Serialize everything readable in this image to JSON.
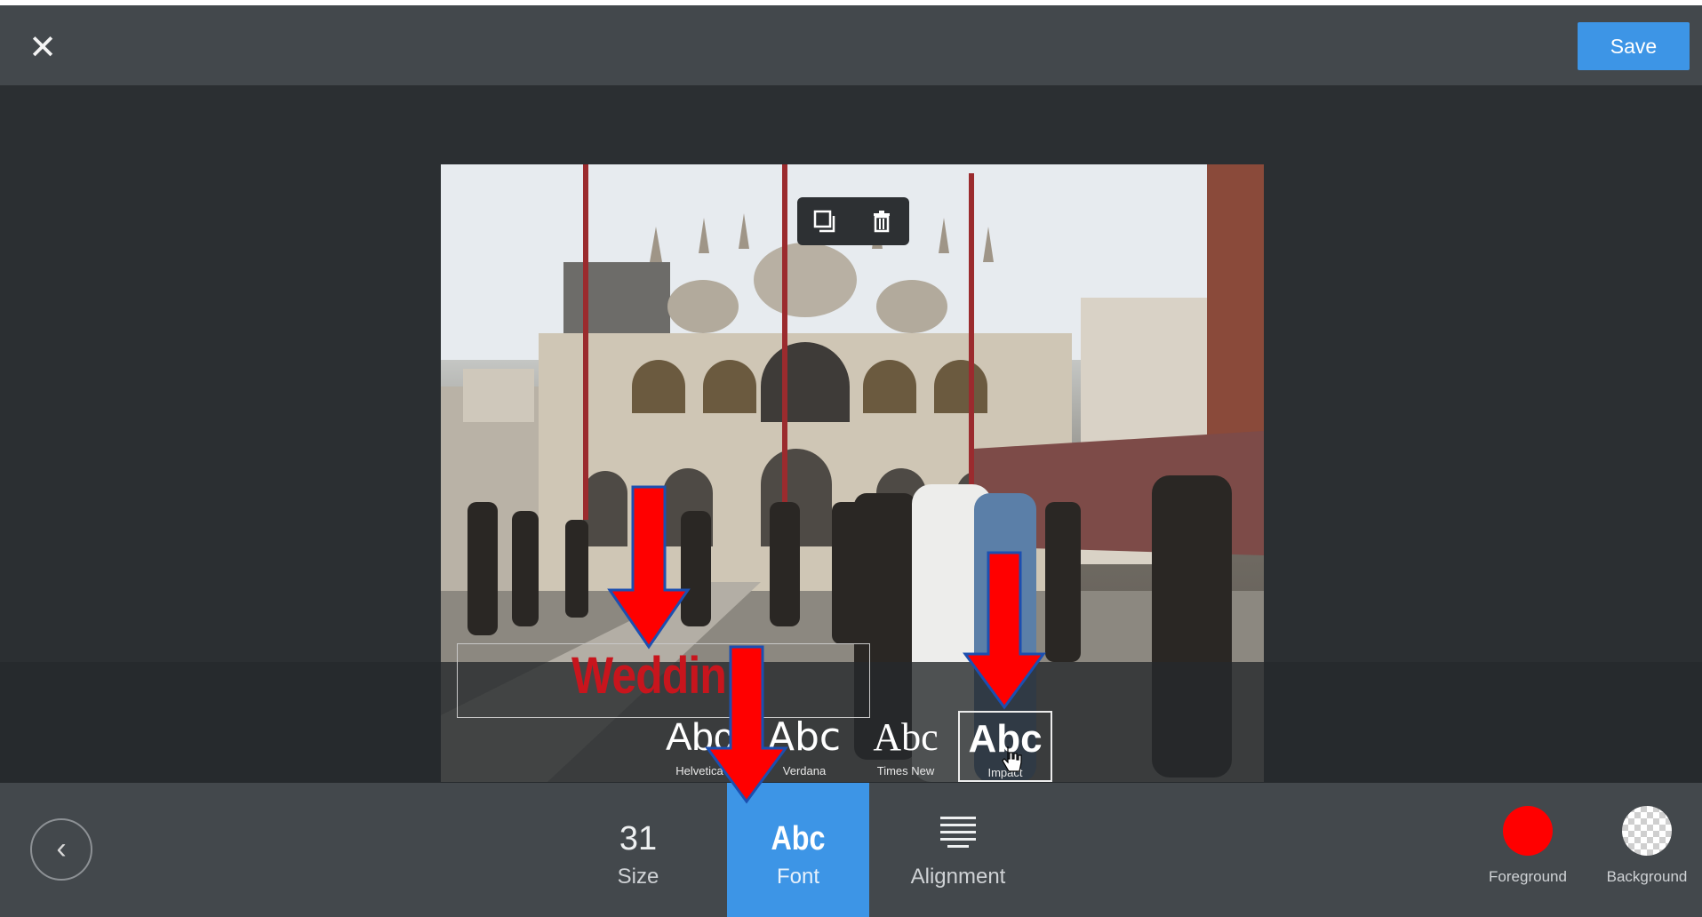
{
  "toolbar": {
    "close_glyph": "✕",
    "save_label": "Save"
  },
  "canvas": {
    "text_content": "Weddin"
  },
  "floating_toolbar": {
    "icons": [
      "duplicate-icon",
      "trash-icon"
    ]
  },
  "font_options": [
    {
      "sample": "Abc",
      "name": "Helvetica"
    },
    {
      "sample": "Abc",
      "name": "Verdana"
    },
    {
      "sample": "Abc",
      "name": "Times New"
    },
    {
      "sample": "Abc",
      "name": "Impact",
      "selected": true
    }
  ],
  "bottom": {
    "back_glyph": "‹",
    "size_value": "31",
    "size_label": "Size",
    "font_sample": "Abc",
    "font_label": "Font",
    "alignment_label": "Alignment",
    "foreground_label": "Foreground",
    "background_label": "Background"
  },
  "colors": {
    "accent": "#3d95e6",
    "foreground": "#ff0000",
    "annotation_arrow": "#e00000"
  }
}
